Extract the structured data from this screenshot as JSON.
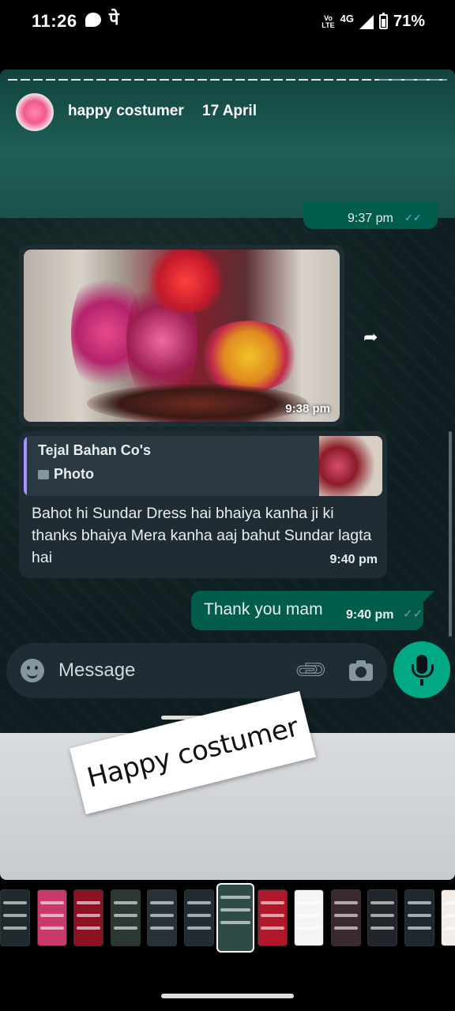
{
  "status_bar": {
    "time": "11:26",
    "extra_glyph": "पे",
    "volte_top": "Vo",
    "volte_bottom": "LTE",
    "network": "4G",
    "battery": "71%"
  },
  "story": {
    "username": "happy costumer",
    "date": "17 April",
    "sticker_text": "Happy costumer"
  },
  "chat": {
    "previous_time": "9:37 pm",
    "image_message": {
      "time": "9:38 pm"
    },
    "reply_message": {
      "quoted_sender": "Tejal Bahan Co's",
      "quoted_type": "Photo",
      "text": "Bahot hi Sundar Dress hai bhaiya kanha ji ki thanks bhaiya Mera kanha aaj bahut Sundar lagta hai",
      "time": "9:40 pm"
    },
    "outgoing_message": {
      "text": "Thank you mam",
      "time": "9:40 pm",
      "status": "read"
    },
    "input": {
      "placeholder": "Message"
    }
  },
  "thumbnails": {
    "count": 13,
    "active_index": 6,
    "colors": [
      "#1d2b2f",
      "#c93a6a",
      "#8b1220",
      "#2a3a30",
      "#263238",
      "#1f2c33",
      "#2e4b47",
      "#b0172a",
      "#f5f5f5",
      "#3a2a30",
      "#20262b",
      "#1c2a30",
      "#f3eee8"
    ]
  },
  "colors": {
    "incoming_bubble": "#1f2c33",
    "outgoing_bubble": "#005c4b",
    "accent": "#00a884",
    "quote_bar": "#a791ff"
  }
}
